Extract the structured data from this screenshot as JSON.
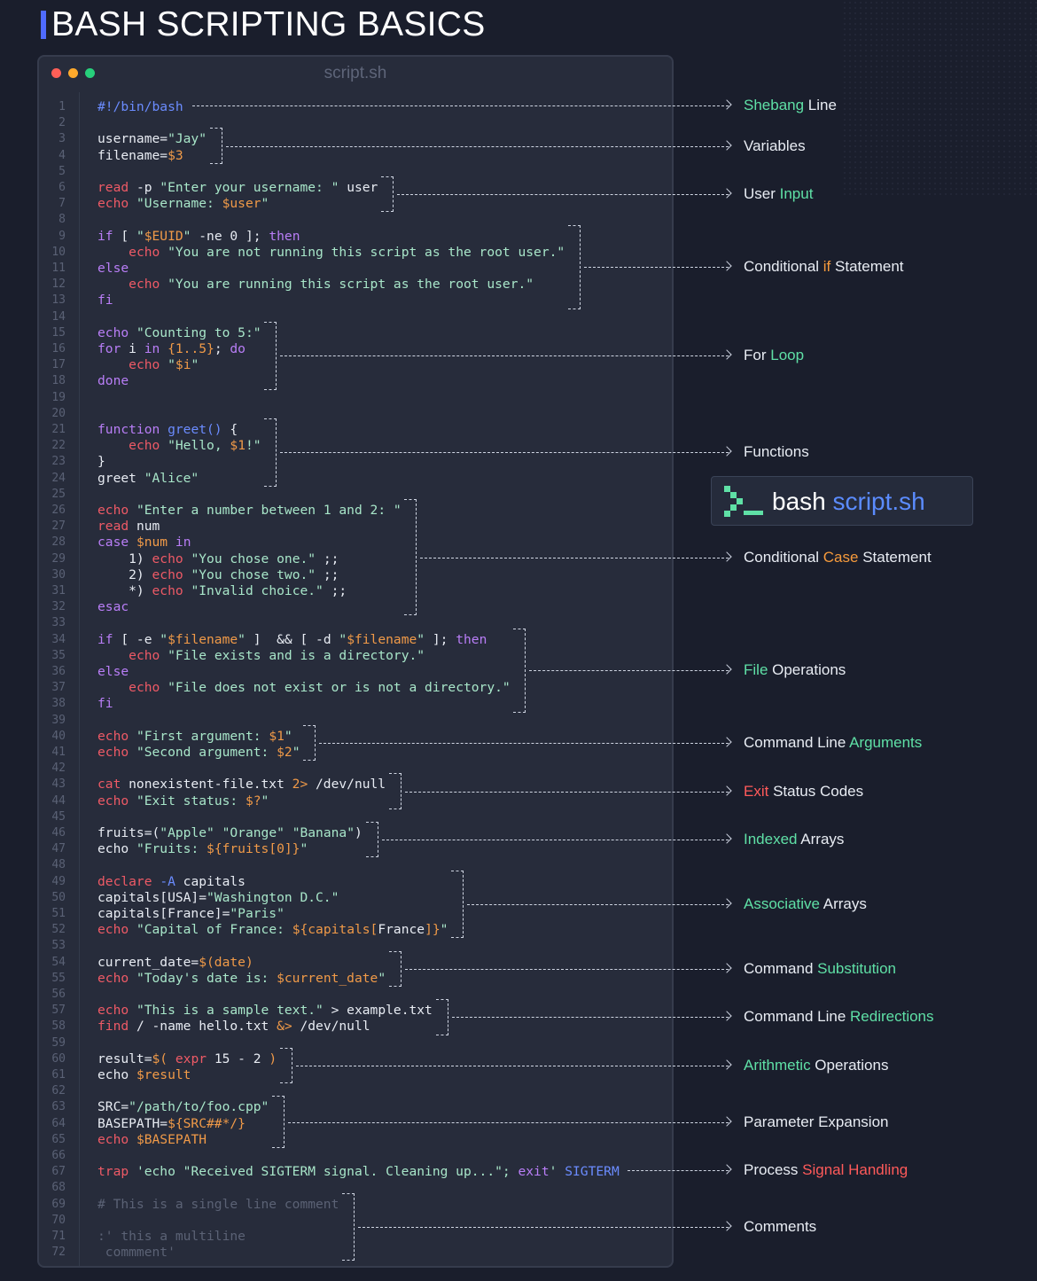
{
  "title": "BASH SCRIPTING BASICS",
  "editor": {
    "filename": "script.sh",
    "dots": [
      "#ff5f57",
      "#ffaa2c",
      "#27d07b"
    ]
  },
  "badge": {
    "command": "bash",
    "file": "script.sh"
  },
  "code_lines": [
    {
      "n": 1,
      "tokens": [
        [
          "#!/bin/bash",
          "fn"
        ]
      ]
    },
    {
      "n": 2,
      "tokens": []
    },
    {
      "n": 3,
      "tokens": [
        [
          "username=",
          "st"
        ],
        [
          "\"Jay\"",
          "str"
        ]
      ]
    },
    {
      "n": 4,
      "tokens": [
        [
          "filename=",
          "st"
        ],
        [
          "$3",
          "var"
        ]
      ]
    },
    {
      "n": 5,
      "tokens": []
    },
    {
      "n": 6,
      "tokens": [
        [
          "read",
          "kw"
        ],
        [
          " -p ",
          "st"
        ],
        [
          "\"Enter your username: \"",
          "str"
        ],
        [
          " user",
          "st"
        ]
      ]
    },
    {
      "n": 7,
      "tokens": [
        [
          "echo",
          "kw"
        ],
        [
          " ",
          "st"
        ],
        [
          "\"Username: ",
          "str"
        ],
        [
          "$user",
          "var"
        ],
        [
          "\"",
          "str"
        ]
      ]
    },
    {
      "n": 8,
      "tokens": []
    },
    {
      "n": 9,
      "tokens": [
        [
          "if",
          "cm"
        ],
        [
          " [ ",
          "st"
        ],
        [
          "\"",
          "str"
        ],
        [
          "$EUID",
          "var"
        ],
        [
          "\"",
          "str"
        ],
        [
          " -ne 0 ]; ",
          "st"
        ],
        [
          "then",
          "cm"
        ]
      ]
    },
    {
      "n": 10,
      "tokens": [
        [
          "    ",
          "st"
        ],
        [
          "echo",
          "kw"
        ],
        [
          " ",
          "st"
        ],
        [
          "\"You are not running this script as the root user.\"",
          "str"
        ]
      ]
    },
    {
      "n": 11,
      "tokens": [
        [
          "else",
          "cm"
        ]
      ]
    },
    {
      "n": 12,
      "tokens": [
        [
          "    ",
          "st"
        ],
        [
          "echo",
          "kw"
        ],
        [
          " ",
          "st"
        ],
        [
          "\"You are running this script as the root user.\"",
          "str"
        ]
      ]
    },
    {
      "n": 13,
      "tokens": [
        [
          "fi",
          "cm"
        ]
      ]
    },
    {
      "n": 14,
      "tokens": []
    },
    {
      "n": 15,
      "tokens": [
        [
          "echo",
          "cm"
        ],
        [
          " ",
          "st"
        ],
        [
          "\"Counting to 5:\"",
          "str"
        ]
      ]
    },
    {
      "n": 16,
      "tokens": [
        [
          "for",
          "cm"
        ],
        [
          " i ",
          "st"
        ],
        [
          "in",
          "cm"
        ],
        [
          " ",
          "st"
        ],
        [
          "{1..5}",
          "var"
        ],
        [
          "; ",
          "st"
        ],
        [
          "do",
          "cm"
        ]
      ]
    },
    {
      "n": 17,
      "tokens": [
        [
          "    ",
          "st"
        ],
        [
          "echo",
          "kw"
        ],
        [
          " ",
          "st"
        ],
        [
          "\"",
          "str"
        ],
        [
          "$i",
          "var"
        ],
        [
          "\"",
          "str"
        ]
      ]
    },
    {
      "n": 18,
      "tokens": [
        [
          "done",
          "cm"
        ]
      ]
    },
    {
      "n": 19,
      "tokens": []
    },
    {
      "n": 20,
      "tokens": []
    },
    {
      "n": 21,
      "tokens": [
        [
          "function",
          "cm"
        ],
        [
          " ",
          "st"
        ],
        [
          "greet()",
          "fn"
        ],
        [
          " {",
          "st"
        ]
      ]
    },
    {
      "n": 22,
      "tokens": [
        [
          "    ",
          "st"
        ],
        [
          "echo",
          "kw"
        ],
        [
          " ",
          "st"
        ],
        [
          "\"Hello, ",
          "str"
        ],
        [
          "$1",
          "var"
        ],
        [
          "!\"",
          "str"
        ]
      ]
    },
    {
      "n": 23,
      "tokens": [
        [
          "}",
          "st"
        ]
      ]
    },
    {
      "n": 24,
      "tokens": [
        [
          "greet ",
          "st"
        ],
        [
          "\"Alice\"",
          "str"
        ]
      ]
    },
    {
      "n": 25,
      "tokens": []
    },
    {
      "n": 26,
      "tokens": [
        [
          "echo",
          "kw"
        ],
        [
          " ",
          "st"
        ],
        [
          "\"Enter a number between 1 and 2: \"",
          "str"
        ]
      ]
    },
    {
      "n": 27,
      "tokens": [
        [
          "read",
          "kw"
        ],
        [
          " num",
          "st"
        ]
      ]
    },
    {
      "n": 28,
      "tokens": [
        [
          "case",
          "cm"
        ],
        [
          " ",
          "st"
        ],
        [
          "$num",
          "var"
        ],
        [
          " ",
          "st"
        ],
        [
          "in",
          "cm"
        ]
      ]
    },
    {
      "n": 29,
      "tokens": [
        [
          "    1) ",
          "st"
        ],
        [
          "echo",
          "kw"
        ],
        [
          " ",
          "st"
        ],
        [
          "\"You chose one.\"",
          "str"
        ],
        [
          " ;;",
          "st"
        ]
      ]
    },
    {
      "n": 30,
      "tokens": [
        [
          "    2) ",
          "st"
        ],
        [
          "echo",
          "kw"
        ],
        [
          " ",
          "st"
        ],
        [
          "\"You chose two.\"",
          "str"
        ],
        [
          " ;;",
          "st"
        ]
      ]
    },
    {
      "n": 31,
      "tokens": [
        [
          "    *) ",
          "st"
        ],
        [
          "echo",
          "kw"
        ],
        [
          " ",
          "st"
        ],
        [
          "\"Invalid choice.\"",
          "str"
        ],
        [
          " ;;",
          "st"
        ]
      ]
    },
    {
      "n": 32,
      "tokens": [
        [
          "esac",
          "cm"
        ]
      ]
    },
    {
      "n": 33,
      "tokens": []
    },
    {
      "n": 34,
      "tokens": [
        [
          "if",
          "cm"
        ],
        [
          " [ -e ",
          "st"
        ],
        [
          "\"",
          "str"
        ],
        [
          "$filename",
          "var"
        ],
        [
          "\"",
          "str"
        ],
        [
          " ]  && [ -d ",
          "st"
        ],
        [
          "\"",
          "str"
        ],
        [
          "$filename",
          "var"
        ],
        [
          "\"",
          "str"
        ],
        [
          " ]; ",
          "st"
        ],
        [
          "then",
          "cm"
        ]
      ]
    },
    {
      "n": 35,
      "tokens": [
        [
          "    ",
          "st"
        ],
        [
          "echo",
          "kw"
        ],
        [
          " ",
          "st"
        ],
        [
          "\"File exists and is a directory.\"",
          "str"
        ]
      ]
    },
    {
      "n": 36,
      "tokens": [
        [
          "else",
          "cm"
        ]
      ]
    },
    {
      "n": 37,
      "tokens": [
        [
          "    ",
          "st"
        ],
        [
          "echo",
          "kw"
        ],
        [
          " ",
          "st"
        ],
        [
          "\"File does not exist or is not a directory.\"",
          "str"
        ]
      ]
    },
    {
      "n": 38,
      "tokens": [
        [
          "fi",
          "cm"
        ]
      ]
    },
    {
      "n": 39,
      "tokens": []
    },
    {
      "n": 40,
      "tokens": [
        [
          "echo",
          "kw"
        ],
        [
          " ",
          "st"
        ],
        [
          "\"First argument: ",
          "str"
        ],
        [
          "$1",
          "var"
        ],
        [
          "\"",
          "str"
        ]
      ]
    },
    {
      "n": 41,
      "tokens": [
        [
          "echo",
          "kw"
        ],
        [
          " ",
          "st"
        ],
        [
          "\"Second argument: ",
          "str"
        ],
        [
          "$2",
          "var"
        ],
        [
          "\"",
          "str"
        ]
      ]
    },
    {
      "n": 42,
      "tokens": []
    },
    {
      "n": 43,
      "tokens": [
        [
          "cat",
          "kw"
        ],
        [
          " nonexistent-file.txt ",
          "st"
        ],
        [
          "2>",
          "var"
        ],
        [
          " /dev/null",
          "st"
        ]
      ]
    },
    {
      "n": 44,
      "tokens": [
        [
          "echo",
          "kw"
        ],
        [
          " ",
          "st"
        ],
        [
          "\"Exit status: ",
          "str"
        ],
        [
          "$?",
          "var"
        ],
        [
          "\"",
          "str"
        ]
      ]
    },
    {
      "n": 45,
      "tokens": []
    },
    {
      "n": 46,
      "tokens": [
        [
          "fruits=(",
          "st"
        ],
        [
          "\"Apple\"",
          "str"
        ],
        [
          " ",
          "st"
        ],
        [
          "\"Orange\"",
          "str"
        ],
        [
          " ",
          "st"
        ],
        [
          "\"Banana\"",
          "str"
        ],
        [
          ")",
          "st"
        ]
      ]
    },
    {
      "n": 47,
      "tokens": [
        [
          "echo",
          "st"
        ],
        [
          " ",
          "st"
        ],
        [
          "\"Fruits: ",
          "str"
        ],
        [
          "${fruits[0]}",
          "var"
        ],
        [
          "\"",
          "str"
        ]
      ]
    },
    {
      "n": 48,
      "tokens": []
    },
    {
      "n": 49,
      "tokens": [
        [
          "declare",
          "kw"
        ],
        [
          " ",
          "st"
        ],
        [
          "-A",
          "fn"
        ],
        [
          " capitals",
          "st"
        ]
      ]
    },
    {
      "n": 50,
      "tokens": [
        [
          "capitals[USA]=",
          "st"
        ],
        [
          "\"Washington D.C.\"",
          "str"
        ]
      ]
    },
    {
      "n": 51,
      "tokens": [
        [
          "capitals[France]=",
          "st"
        ],
        [
          "\"Paris\"",
          "str"
        ]
      ]
    },
    {
      "n": 52,
      "tokens": [
        [
          "echo",
          "kw"
        ],
        [
          " ",
          "st"
        ],
        [
          "\"Capital of France: ",
          "str"
        ],
        [
          "${capitals[",
          "var"
        ],
        [
          "France",
          "st"
        ],
        [
          "]}",
          "var"
        ],
        [
          "\"",
          "str"
        ]
      ]
    },
    {
      "n": 53,
      "tokens": []
    },
    {
      "n": 54,
      "tokens": [
        [
          "current_date=",
          "st"
        ],
        [
          "$(date)",
          "var"
        ]
      ]
    },
    {
      "n": 55,
      "tokens": [
        [
          "echo",
          "kw"
        ],
        [
          " ",
          "st"
        ],
        [
          "\"Today's date is: ",
          "str"
        ],
        [
          "$current_date",
          "var"
        ],
        [
          "\"",
          "str"
        ]
      ]
    },
    {
      "n": 56,
      "tokens": []
    },
    {
      "n": 57,
      "tokens": [
        [
          "echo",
          "kw"
        ],
        [
          " ",
          "st"
        ],
        [
          "\"This is a sample text.\"",
          "str"
        ],
        [
          " > example.txt",
          "st"
        ]
      ]
    },
    {
      "n": 58,
      "tokens": [
        [
          "find",
          "kw"
        ],
        [
          " / -name hello.txt ",
          "st"
        ],
        [
          "&>",
          "var"
        ],
        [
          " /dev/null",
          "st"
        ]
      ]
    },
    {
      "n": 59,
      "tokens": []
    },
    {
      "n": 60,
      "tokens": [
        [
          "result=",
          "st"
        ],
        [
          "$( ",
          "var"
        ],
        [
          "expr",
          "kw"
        ],
        [
          " 15 - 2 ",
          "st"
        ],
        [
          ")",
          "var"
        ]
      ]
    },
    {
      "n": 61,
      "tokens": [
        [
          "echo ",
          "st"
        ],
        [
          "$result",
          "var"
        ]
      ]
    },
    {
      "n": 62,
      "tokens": []
    },
    {
      "n": 63,
      "tokens": [
        [
          "SRC=",
          "st"
        ],
        [
          "\"/path/to/foo.cpp\"",
          "str"
        ]
      ]
    },
    {
      "n": 64,
      "tokens": [
        [
          "BASEPATH=",
          "st"
        ],
        [
          "${SRC##*/}",
          "var"
        ]
      ]
    },
    {
      "n": 65,
      "tokens": [
        [
          "echo",
          "kw"
        ],
        [
          " ",
          "st"
        ],
        [
          "$BASEPATH",
          "var"
        ]
      ]
    },
    {
      "n": 66,
      "tokens": []
    },
    {
      "n": 67,
      "tokens": [
        [
          "trap",
          "kw"
        ],
        [
          " ",
          "st"
        ],
        [
          "'echo \"Received SIGTERM signal. Cleaning up...\"; ",
          "str"
        ],
        [
          "exit",
          "cm"
        ],
        [
          "'",
          "str"
        ],
        [
          " ",
          "st"
        ],
        [
          "SIGTERM",
          "fn"
        ]
      ]
    },
    {
      "n": 68,
      "tokens": []
    },
    {
      "n": 69,
      "tokens": [
        [
          "# This is a single line comment",
          "com"
        ]
      ]
    },
    {
      "n": 70,
      "tokens": []
    },
    {
      "n": 71,
      "tokens": [
        [
          ":' this a multiline",
          "com"
        ]
      ]
    },
    {
      "n": 72,
      "tokens": [
        [
          " commment'",
          "com"
        ]
      ]
    }
  ],
  "annotations": [
    {
      "key": "shebang",
      "parts": [
        [
          "Shebang",
          "g"
        ],
        [
          " Line",
          ""
        ]
      ],
      "first": 1,
      "last": 1
    },
    {
      "key": "variables",
      "parts": [
        [
          "Variables",
          ""
        ]
      ],
      "first": 3,
      "last": 4
    },
    {
      "key": "user-input",
      "parts": [
        [
          "User ",
          ""
        ],
        [
          "Input",
          "g"
        ]
      ],
      "first": 6,
      "last": 7
    },
    {
      "key": "conditional-if",
      "parts": [
        [
          "Conditional ",
          ""
        ],
        [
          "if",
          "o"
        ],
        [
          " Statement",
          ""
        ]
      ],
      "first": 9,
      "last": 13
    },
    {
      "key": "for-loop",
      "parts": [
        [
          "For ",
          ""
        ],
        [
          "Loop",
          "g"
        ]
      ],
      "first": 15,
      "last": 18
    },
    {
      "key": "functions",
      "parts": [
        [
          "Functions",
          ""
        ]
      ],
      "first": 21,
      "last": 24
    },
    {
      "key": "conditional-case",
      "parts": [
        [
          "Conditional ",
          ""
        ],
        [
          "Case",
          "o"
        ],
        [
          " Statement",
          ""
        ]
      ],
      "first": 26,
      "last": 32
    },
    {
      "key": "file-operations",
      "parts": [
        [
          "File",
          "g"
        ],
        [
          " Operations",
          ""
        ]
      ],
      "first": 34,
      "last": 38
    },
    {
      "key": "command-line-arguments",
      "parts": [
        [
          "Command Line ",
          ""
        ],
        [
          "Arguments",
          "g"
        ]
      ],
      "first": 40,
      "last": 41
    },
    {
      "key": "exit-status-codes",
      "parts": [
        [
          "Exit",
          "r"
        ],
        [
          " Status Codes",
          ""
        ]
      ],
      "first": 43,
      "last": 44
    },
    {
      "key": "indexed-arrays",
      "parts": [
        [
          "Indexed",
          "g"
        ],
        [
          " Arrays",
          ""
        ]
      ],
      "first": 46,
      "last": 47
    },
    {
      "key": "associative-arrays",
      "parts": [
        [
          "Associative",
          "g"
        ],
        [
          " Arrays",
          ""
        ]
      ],
      "first": 49,
      "last": 52
    },
    {
      "key": "command-substitution",
      "parts": [
        [
          "Command ",
          ""
        ],
        [
          "Substitution",
          "g"
        ]
      ],
      "first": 54,
      "last": 55
    },
    {
      "key": "command-line-redirections",
      "parts": [
        [
          "Command Line ",
          ""
        ],
        [
          "Redirections",
          "g"
        ]
      ],
      "first": 57,
      "last": 58
    },
    {
      "key": "arithmetic-operations",
      "parts": [
        [
          "Arithmetic",
          "g"
        ],
        [
          " Operations",
          ""
        ]
      ],
      "first": 60,
      "last": 61
    },
    {
      "key": "parameter-expansion",
      "parts": [
        [
          "Parameter Expansion",
          ""
        ]
      ],
      "first": 63,
      "last": 65
    },
    {
      "key": "process-signal-handling",
      "parts": [
        [
          "Process ",
          ""
        ],
        [
          "Signal Handling",
          "r"
        ]
      ],
      "first": 67,
      "last": 67
    },
    {
      "key": "comments",
      "parts": [
        [
          "Comments",
          ""
        ]
      ],
      "first": 69,
      "last": 72
    }
  ]
}
